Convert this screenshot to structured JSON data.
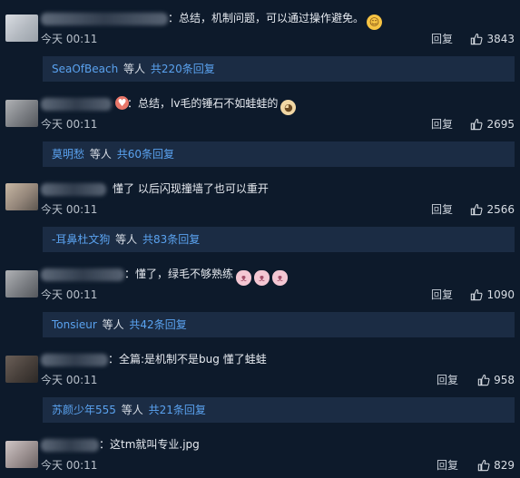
{
  "comments": [
    {
      "text": "：总结，机制问题，可以通过操作避免。",
      "emoji": "yellow",
      "emoji_char": "☺",
      "time": "今天 00:11",
      "reply_label": "回复",
      "likes": "3843",
      "replies_user": "SeaOfBeach",
      "replies_etal": "等人",
      "replies_count": "共220条回复"
    },
    {
      "text": "：总结，lv毛的锤石不如蛙蛙的",
      "emoji": "cat",
      "emoji_char": "◕",
      "time": "今天 00:11",
      "reply_label": "回复",
      "likes": "2695",
      "replies_user": "莫明愁",
      "replies_etal": "等人",
      "replies_count": "共60条回复"
    },
    {
      "text": "懂了 以后闪现撞墙了也可以重开",
      "emoji": "",
      "emoji_char": "",
      "time": "今天 00:11",
      "reply_label": "回复",
      "likes": "2566",
      "replies_user": "-耳鼻杜文狗",
      "replies_etal": "等人",
      "replies_count": "共83条回复"
    },
    {
      "text": "：懂了，绿毛不够熟练",
      "emoji": "pink",
      "emoji_char": "ᵔᴥᵔ",
      "time": "今天 00:11",
      "reply_label": "回复",
      "likes": "1090",
      "replies_user": "Tonsieur",
      "replies_etal": "等人",
      "replies_count": "共42条回复"
    },
    {
      "text": "：全篇:是机制不是bug 懂了蛙蛙",
      "emoji": "",
      "emoji_char": "",
      "time": "今天 00:11",
      "reply_label": "回复",
      "likes": "958",
      "replies_user": "苏颜少年555",
      "replies_etal": "等人",
      "replies_count": "共21条回复"
    },
    {
      "text": "：这tm就叫专业.jpg",
      "emoji": "",
      "emoji_char": "",
      "time": "今天 00:11",
      "reply_label": "回复",
      "likes": "829",
      "replies_user": "",
      "replies_etal": "",
      "replies_count": ""
    }
  ],
  "colors": {
    "background": "#0d1a2b",
    "reply_box": "#1b2c44",
    "link_blue": "#5aa2ef"
  }
}
